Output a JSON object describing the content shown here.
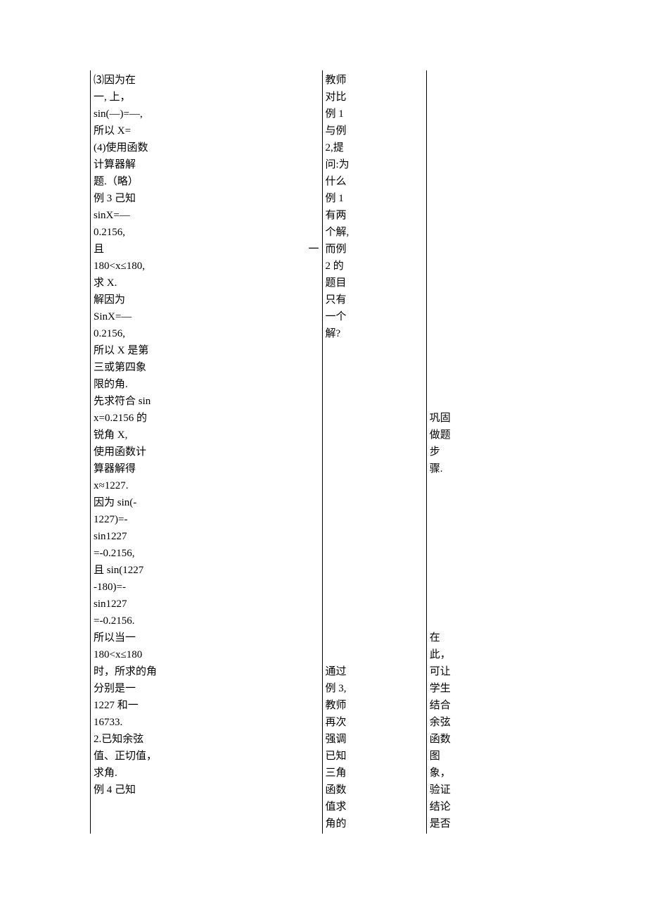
{
  "col1": {
    "l1": "⑶因为在",
    "l2": "一, 上，",
    "l3": "sin(—)=—,",
    "l4": "所以 X=",
    "l5": "",
    "l6": "(4)使用函数",
    "l7": "计算器解",
    "l8": "题.（略）",
    "l9": "",
    "l10": "例 3 己知",
    "l11": "sinX=—",
    "l12": "0.2156,",
    "l13a": "且",
    "l13b": "一",
    "l14": "180<x≤180,",
    "l15": "求 X.",
    "l16": "解因为",
    "l17": "SinX=—",
    "l18": "0.2156,",
    "l19": "所以 X 是第",
    "l20": "三或第四象",
    "l21": "限的角.",
    "l22": "先求符合 sin",
    "l23": "x=0.2156 的",
    "l24": "锐角 X,",
    "l25": "使用函数计",
    "l26": "算器解得",
    "l27": "x≈1227.",
    "l28": "因为 sin(-",
    "l29": "1227)=-",
    "l30": "sin1227",
    "l31": "=-0.2156,",
    "l32": "且 sin(1227",
    "l33": "-180)=-",
    "l34": "sin1227",
    "l35": "=-0.2156.",
    "l36": "所以当一",
    "l37": "180<x≤180",
    "l38": "时，所求的角",
    "l39": "分别是一",
    "l40": "1227 和一",
    "l41": "16733.",
    "l42": "2.已知余弦",
    "l43": "值、正切值，",
    "l44": "求角.",
    "l45": "例 4 己知"
  },
  "col2": {
    "l1": "教师",
    "l2": "对比",
    "l3": "例 1",
    "l4": "与例",
    "l5": "2,提",
    "l6": "问:为",
    "l7": "什么",
    "l8": "例 1",
    "l9": "有两",
    "l10": "个解,",
    "l11": "而例",
    "l12": "2 的",
    "l13": "题目",
    "l14": "只有",
    "l15": "一个",
    "l16": "解?",
    "l36": "通过",
    "l37": "例 3,",
    "l38": "教师",
    "l39": "再次",
    "l40": "强调",
    "l41": "已知",
    "l42": "三角",
    "l43": "函数",
    "l44": "值求",
    "l45": "角的"
  },
  "col3": {
    "l21": "巩固",
    "l22": "做题",
    "l23": "步",
    "l24": "骤.",
    "l34": "在",
    "l35": "此，",
    "l36": "可让",
    "l37": "学生",
    "l38": "结合",
    "l39": "余弦",
    "l40": "函数",
    "l41": "图",
    "l42": "象，",
    "l43": "验证",
    "l44": "结论",
    "l45": "是否"
  }
}
